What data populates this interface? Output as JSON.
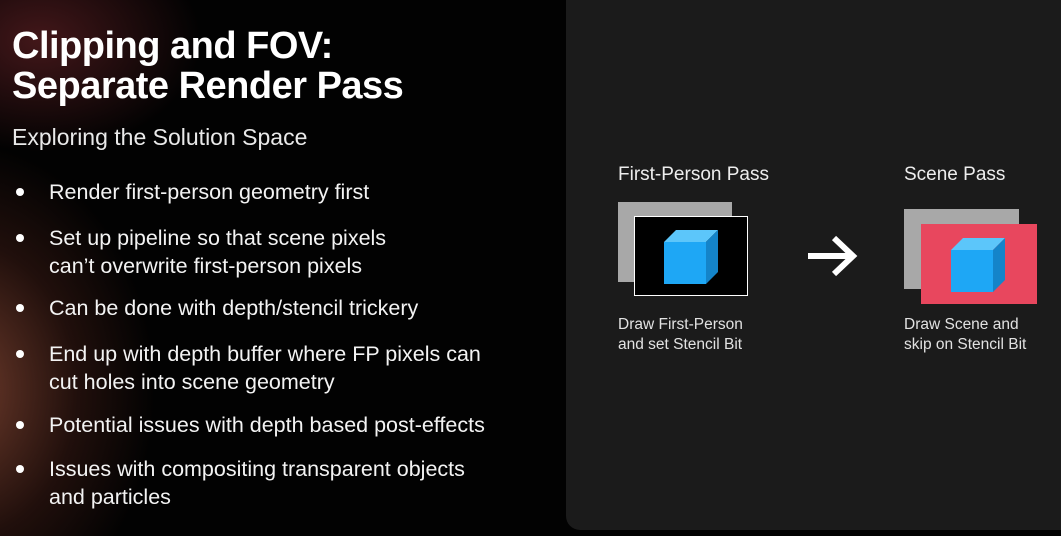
{
  "slide": {
    "title_lines": [
      "Clipping and FOV:",
      "Separate Render Pass"
    ],
    "subtitle": "Exploring the Solution Space",
    "bullets": [
      {
        "lines": [
          "Render first-person geometry first"
        ]
      },
      {
        "lines": [
          "Set up pipeline so that scene pixels",
          "can’t overwrite first-person pixels"
        ]
      },
      {
        "lines": [
          "Can be done with depth/stencil trickery"
        ]
      },
      {
        "lines": [
          "End up with depth buffer where FP pixels can",
          "cut holes into scene geometry"
        ]
      },
      {
        "lines": [
          "Potential issues with depth based post-effects"
        ]
      },
      {
        "lines": [
          "Issues with compositing transparent objects",
          "and particles"
        ]
      }
    ]
  },
  "diagram": {
    "first_person": {
      "label": "First-Person Pass",
      "caption_lines": [
        "Draw First-Person",
        "and set Stencil Bit"
      ]
    },
    "arrow": "→",
    "scene": {
      "label": "Scene Pass",
      "caption_lines": [
        "Draw Scene and",
        "skip on Stencil Bit"
      ]
    },
    "colors": {
      "back_frame": "#a8a8a8",
      "fp_frame_fill": "#000000",
      "fp_frame_border": "#ffffff",
      "scene_frame": "#e8475e",
      "cube_front": "#1ea7f5",
      "cube_top": "#5cc6fa",
      "cube_side": "#1484c9",
      "panel_bg": "#1b1b1b"
    }
  }
}
